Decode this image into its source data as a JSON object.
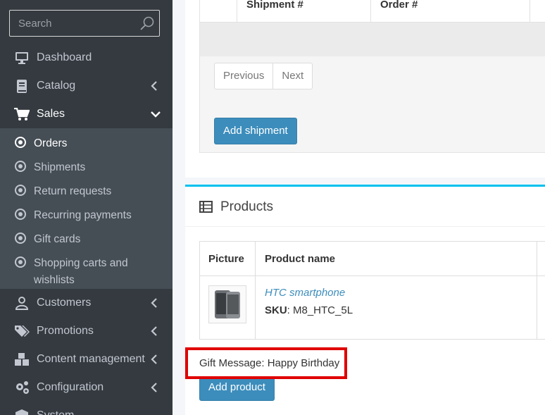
{
  "sidebar": {
    "search_placeholder": "Search",
    "items": [
      {
        "label": "Dashboard",
        "icon": "monitor-icon"
      },
      {
        "label": "Catalog",
        "icon": "book-icon"
      },
      {
        "label": "Sales",
        "icon": "cart-icon"
      },
      {
        "label": "Customers",
        "icon": "user-icon"
      },
      {
        "label": "Promotions",
        "icon": "tags-icon"
      },
      {
        "label": "Content management",
        "icon": "cubes-icon"
      },
      {
        "label": "Configuration",
        "icon": "gears-icon"
      },
      {
        "label": "System",
        "icon": "cube-icon"
      }
    ],
    "sales_submenu": [
      {
        "label": "Orders"
      },
      {
        "label": "Shipments"
      },
      {
        "label": "Return requests"
      },
      {
        "label": "Recurring payments"
      },
      {
        "label": "Gift cards"
      },
      {
        "label_line1": "Shopping carts and",
        "label_line2": "wishlists"
      }
    ]
  },
  "shipments": {
    "columns": [
      "Shipment #",
      "Order #"
    ],
    "pager": {
      "previous": "Previous",
      "next": "Next"
    },
    "add_button": "Add shipment"
  },
  "products": {
    "title": "Products",
    "columns": [
      "Picture",
      "Product name"
    ],
    "rows": [
      {
        "name": "HTC smartphone",
        "sku_label": "SKU",
        "sku": ": M8_HTC_5L"
      }
    ],
    "gift_message": "Gift Message: Happy Birthday",
    "add_button": "Add product"
  },
  "colors": {
    "sidebar_bg": "#343a40",
    "submenu_bg": "#454d55",
    "primary": "#3c8dbc",
    "card_top_border": "#00c0ef",
    "highlight_border": "#e00000"
  }
}
